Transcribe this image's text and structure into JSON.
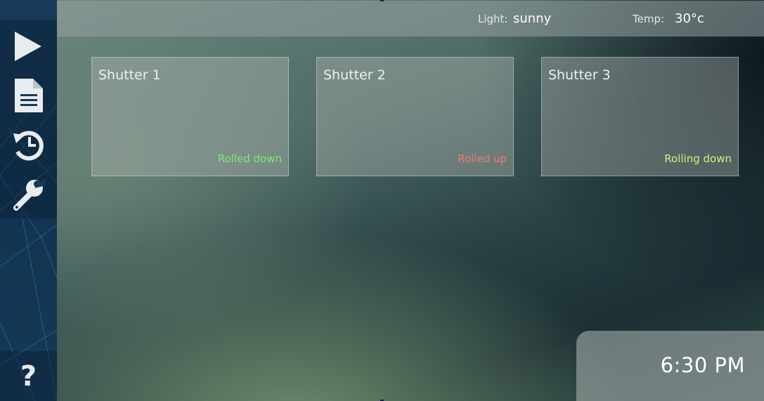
{
  "sidebar": {
    "items": [
      {
        "name": "play",
        "icon": "play-icon"
      },
      {
        "name": "document",
        "icon": "document-icon"
      },
      {
        "name": "history",
        "icon": "history-icon"
      },
      {
        "name": "settings",
        "icon": "wrench-icon"
      },
      {
        "name": "help",
        "icon": "help-icon",
        "label": "?"
      }
    ]
  },
  "topbar": {
    "light_label": "Light:",
    "light_value": "sunny",
    "temp_label": "Temp:",
    "temp_value": "30°c"
  },
  "shutters": [
    {
      "title": "Shutter 1",
      "status": "Rolled down",
      "status_color": "#7ee87a"
    },
    {
      "title": "Shutter 2",
      "status": "Rolled up",
      "status_color": "#f07a72"
    },
    {
      "title": "Shutter 3",
      "status": "Rolling down",
      "status_color": "#d4ef7c"
    }
  ],
  "clock": {
    "time": "6:30 PM"
  },
  "colors": {
    "sidebar": "#143755",
    "icon": "#e8ecef"
  }
}
